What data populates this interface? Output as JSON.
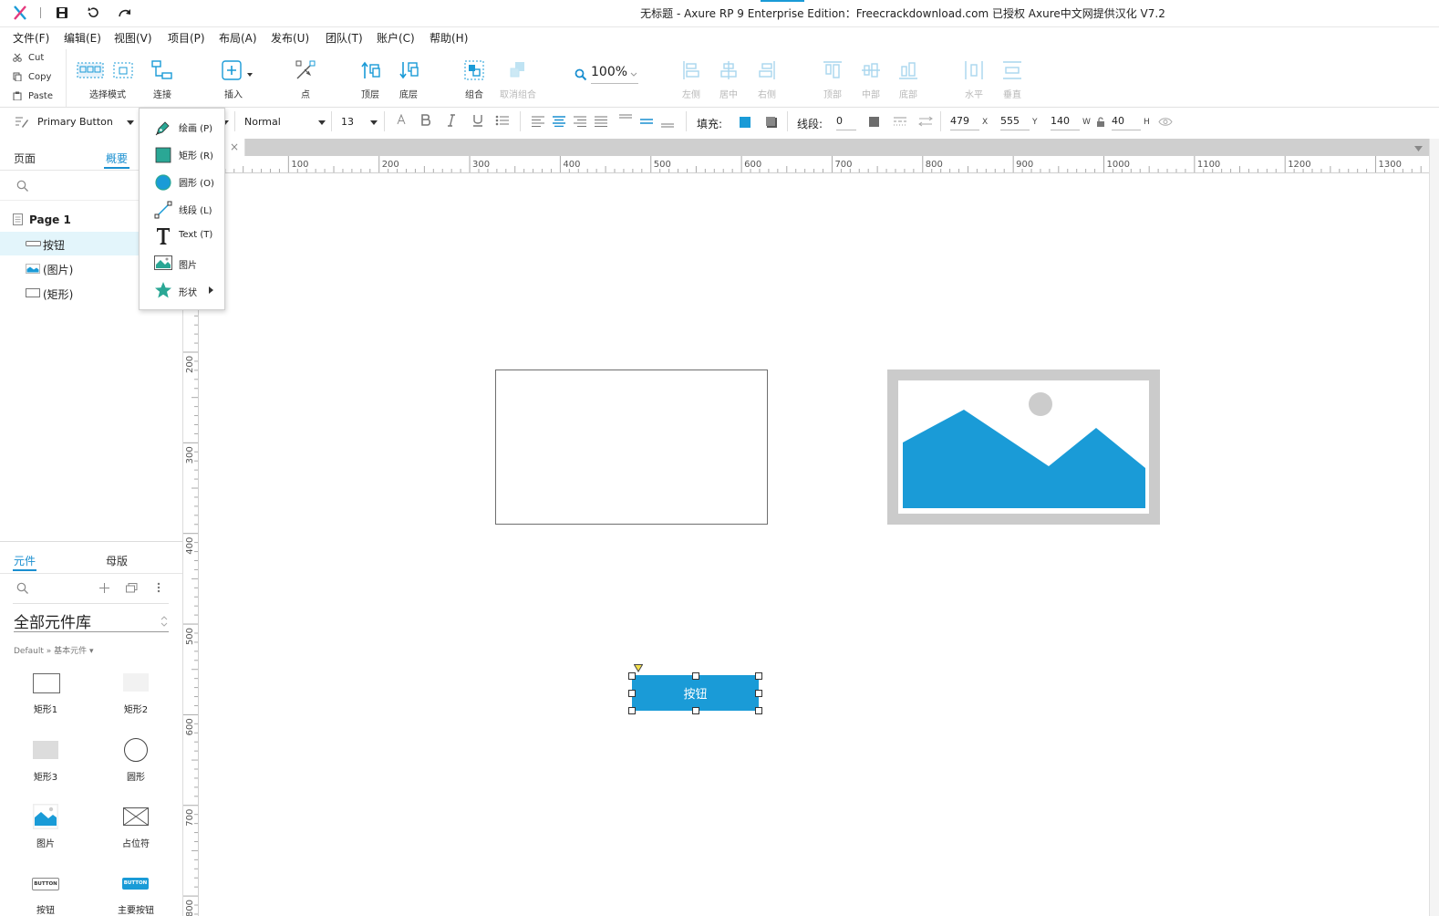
{
  "titlebar": {
    "title": "无标题 - Axure RP 9 Enterprise Edition：Freecrackdownload.com 已授权      Axure中文网提供汉化 V7.2"
  },
  "menubar": {
    "items": [
      "文件(F)",
      "编辑(E)",
      "视图(V)",
      "项目(P)",
      "布局(A)",
      "发布(U)",
      "团队(T)",
      "账户(C)",
      "帮助(H)"
    ]
  },
  "clipboard": {
    "cut": "Cut",
    "copy": "Copy",
    "paste": "Paste"
  },
  "toolbar": {
    "select_mode": "选择模式",
    "connect": "连接",
    "insert": "插入",
    "point": "点",
    "top_layer": "顶层",
    "bottom_layer": "底层",
    "group": "组合",
    "ungroup": "取消组合",
    "zoom": "100%",
    "align_left": "左侧",
    "align_center": "居中",
    "align_right": "右侧",
    "align_top": "顶部",
    "align_middle": "中部",
    "align_bottom": "底部",
    "distribute_h": "水平",
    "distribute_v": "垂直"
  },
  "formatbar": {
    "style_name": "Primary Button",
    "font_weight": "Normal",
    "font_size": "13",
    "fill_label": "填充:",
    "stroke_label": "线段:",
    "stroke_value": "0",
    "x": "479",
    "x_label": "X",
    "y": "555",
    "y_label": "Y",
    "w": "140",
    "w_label": "W",
    "h": "40",
    "h_label": "H",
    "fill_color": "#1a9bd7"
  },
  "left_panel": {
    "tabs": [
      "页面",
      "概要"
    ],
    "tree": {
      "page": "Page 1",
      "items": [
        "按钮",
        "(图片)",
        "(矩形)"
      ]
    },
    "bottom_tabs": [
      "元件",
      "母版"
    ],
    "library_title": "全部元件库",
    "library_path": "Default » 基本元件 ▾",
    "widgets": [
      "矩形1",
      "矩形2",
      "矩形3",
      "圆形",
      "图片",
      "占位符",
      "按钮",
      "主要按钮"
    ],
    "widget_thumb_text": "BUTTON"
  },
  "insert_menu": {
    "items": [
      {
        "label": "绘画 (P)",
        "icon": "pen-icon"
      },
      {
        "label": "矩形 (R)",
        "icon": "rectangle-icon"
      },
      {
        "label": "圆形 (O)",
        "icon": "circle-icon"
      },
      {
        "label": "线段 (L)",
        "icon": "line-icon"
      },
      {
        "label": "Text (T)",
        "icon": "text-icon"
      },
      {
        "label": "图片",
        "icon": "image-icon"
      },
      {
        "label": "形状",
        "icon": "star-icon"
      }
    ]
  },
  "canvas": {
    "tab_close": "×",
    "hruler_ticks": [
      "100",
      "200",
      "300",
      "400",
      "500",
      "600",
      "700",
      "800",
      "900",
      "1000",
      "1100",
      "1200",
      "1300"
    ],
    "vruler_ticks": [
      "200",
      "300",
      "400",
      "500",
      "600",
      "700",
      "800"
    ],
    "button_label": "按钮",
    "button_color": "#1a9bd7"
  }
}
